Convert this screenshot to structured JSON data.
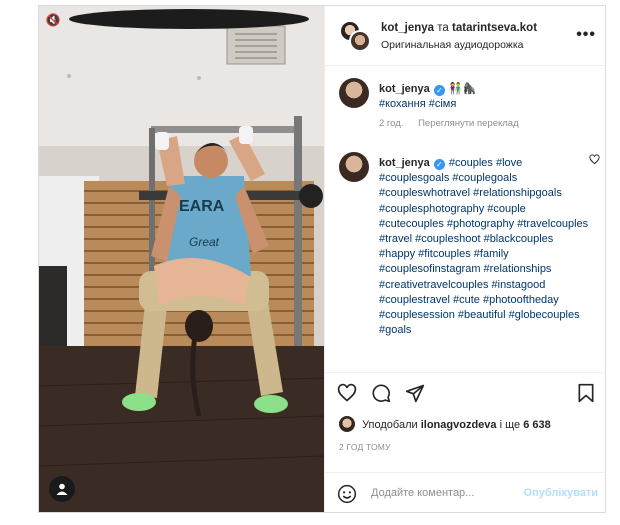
{
  "header": {
    "user1": "kot_jenya",
    "conj": "та",
    "user2": "tatarintseva.kot",
    "audio": "Оригинальная аудиодорожка",
    "more": "•••"
  },
  "comments": [
    {
      "user": "kot_jenya",
      "emoji": "👫🦍",
      "text": "#кохання #сімя",
      "time": "2 год.",
      "translate": "Переглянути переклад"
    },
    {
      "user": "kot_jenya",
      "hashtags": "#couples #love #couplesgoals #couplegoals #coupleswhotravel #relationshipgoals #couplesphotography #couple #cutecouples #photography #travelcouples #travel #coupleshoot #blackcouples #happy #fitcouples #family #couplesofinstagram #relationships #creativetravelcouples #instagood #couplestravel #cute #photooftheday #couplesession #beautiful #globecouples #goals"
    }
  ],
  "likes": {
    "prefix": "Уподобали",
    "user": "ilonagvozdeva",
    "suffix": "і ще",
    "count": "6 638"
  },
  "ago": "2 ГОД ТОМУ",
  "comment_box": {
    "placeholder": "Додайте коментар...",
    "post_label": "Опублікувати"
  },
  "colors": {
    "hashtag": "#00376b",
    "verified": "#3897f0",
    "post_disabled": "#b2dffc"
  },
  "icons": [
    "mute-icon",
    "user-tag-icon",
    "more-icon",
    "verified-icon",
    "heart-icon",
    "comment-icon",
    "share-icon",
    "save-icon",
    "emoji-icon"
  ]
}
